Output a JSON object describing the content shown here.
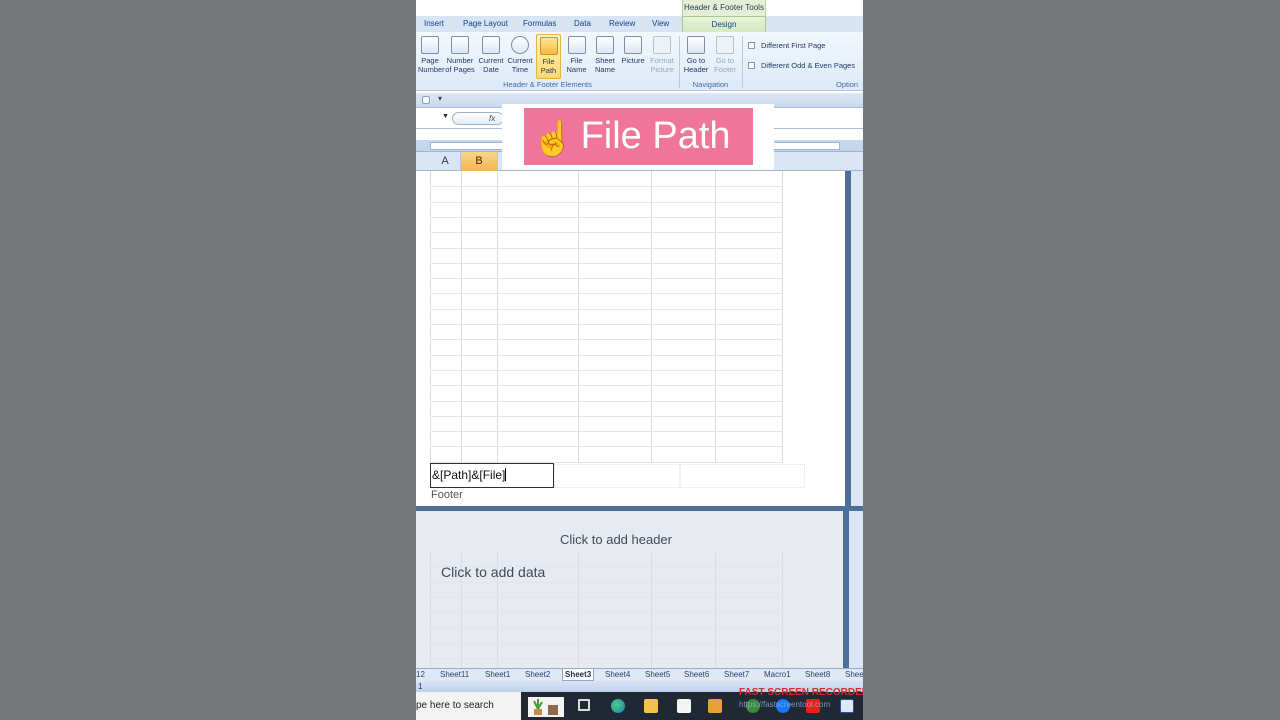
{
  "ribbon": {
    "context_title": "Header & Footer Tools",
    "tabs": [
      "Insert",
      "Page Layout",
      "Formulas",
      "Data",
      "Review",
      "View"
    ],
    "active_tab": "Design",
    "buttons": [
      {
        "line1": "Page",
        "line2": "Number"
      },
      {
        "line1": "Number",
        "line2": "of Pages"
      },
      {
        "line1": "Current",
        "line2": "Date"
      },
      {
        "line1": "Current",
        "line2": "Time"
      },
      {
        "line1": "File",
        "line2": "Path"
      },
      {
        "line1": "File",
        "line2": "Name"
      },
      {
        "line1": "Sheet",
        "line2": "Name"
      },
      {
        "line1": "Picture",
        "line2": ""
      },
      {
        "line1": "Format",
        "line2": "Picture"
      },
      {
        "line1": "Go to",
        "line2": "Header"
      },
      {
        "line1": "Go to",
        "line2": "Footer"
      }
    ],
    "group_elements": "Header & Footer Elements",
    "group_navigation": "Navigation",
    "group_options": "Option",
    "options": [
      "Different First Page",
      "Different Odd & Even Pages"
    ]
  },
  "formula_bar": {
    "fx_symbol": "fx"
  },
  "columns": [
    "A",
    "B"
  ],
  "overlay": {
    "emoji": "☝️",
    "text": "File Path"
  },
  "page1": {
    "footer_left_value": "&[Path]&[File]",
    "footer_label": "Footer"
  },
  "page2": {
    "header_prompt": "Click to add header",
    "data_prompt": "Click to add data"
  },
  "sheet_tabs": [
    "12",
    "Sheet11",
    "Sheet1",
    "Sheet2",
    "Sheet3",
    "Sheet4",
    "Sheet5",
    "Sheet6",
    "Sheet7",
    "Macro1",
    "Sheet8",
    "Shee"
  ],
  "active_sheet": "Sheet3",
  "status_bar": {
    "page_indicator": "1"
  },
  "taskbar": {
    "search_placeholder": "pe here to search",
    "recorder_label": "FAST SCREEN RECORDER",
    "recorder_url": "https://fastscreentool.com"
  },
  "colors": {
    "accent_pink": "#f0759a",
    "selected_column": "#f4b64c",
    "ribbon_text": "#15428b"
  }
}
